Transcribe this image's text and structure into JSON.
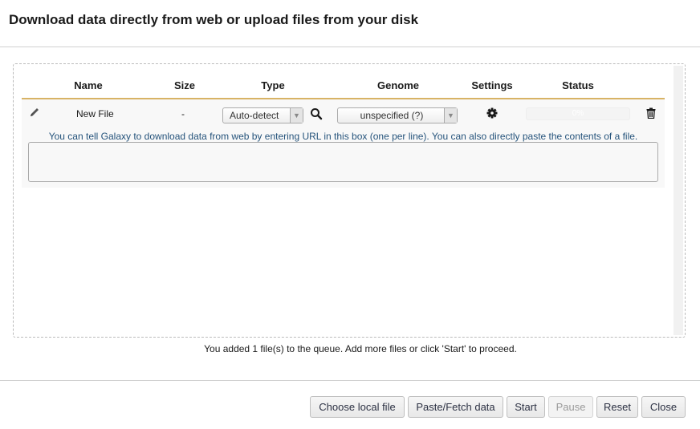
{
  "dialog": {
    "title": "Download data directly from web or upload files from your disk"
  },
  "table": {
    "columns": [
      "Name",
      "Size",
      "Type",
      "Genome",
      "Settings",
      "Status"
    ],
    "row": {
      "name": "New File",
      "size": "-",
      "type_value": "Auto-detect",
      "genome_value": "unspecified (?)",
      "status_text": "0%",
      "progress": 0
    },
    "hint": "You can tell Galaxy to download data from web by entering URL in this box (one per line). You can also directly paste the contents of a file.",
    "url_value": ""
  },
  "queue_message": "You added 1 file(s) to the queue. Add more files or click 'Start' to proceed.",
  "buttons": {
    "choose_local": "Choose local file",
    "paste_fetch": "Paste/Fetch data",
    "start": "Start",
    "pause": "Pause",
    "reset": "Reset",
    "close": "Close"
  },
  "icons": {
    "edit": "pencil-icon",
    "search": "search-icon",
    "settings": "gear-icon",
    "delete": "trash-icon"
  },
  "colors": {
    "header_rule": "#d8b365",
    "hint_text": "#25537b"
  }
}
